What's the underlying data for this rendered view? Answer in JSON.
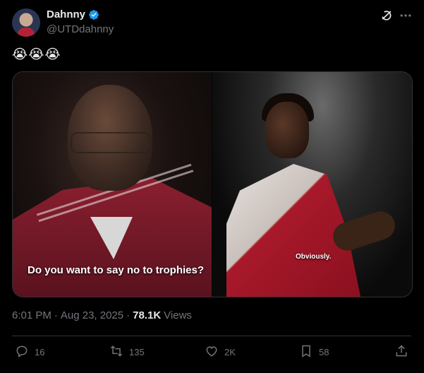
{
  "author": {
    "name": "Dahnny",
    "handle": "@UTDdahnny",
    "avatar_icon": "avatar",
    "verified_icon": "verified-badge-icon",
    "verified_color": "#1d9bf0"
  },
  "header_actions": {
    "grok_icon": "grok-icon",
    "more_icon": "more-icon"
  },
  "tweet": {
    "text": "😭😭😭"
  },
  "media": {
    "left_subtitle": "Do you want to say no to trophies?",
    "right_subtitle": "Obviously."
  },
  "meta": {
    "time": "6:01 PM",
    "dot": "·",
    "date": "Aug 23, 2025",
    "views_count": "78.1K",
    "views_label": "Views"
  },
  "actions": {
    "replies": "16",
    "reposts": "135",
    "likes": "2K",
    "bookmarks": "58"
  }
}
